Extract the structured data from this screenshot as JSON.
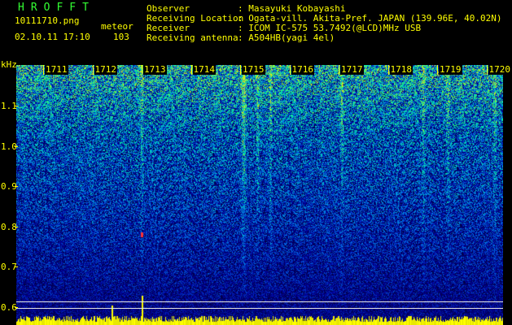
{
  "header": {
    "title": "HROFFT",
    "filename": "10111710.png",
    "date_time": "02.10.11 17:10",
    "mode_label": "meteor",
    "count": "103"
  },
  "station": {
    "observer_label": "Observer",
    "observer_value": ": Masayuki Kobayashi",
    "location_label": "Receiving Location",
    "location_value": ": Ogata-vill. Akita-Pref. JAPAN (139.96E, 40.02N)",
    "receiver_label": "Receiver",
    "receiver_value": ": ICOM IC-575 53.7492(@LCD)MHz USB",
    "antenna_label": "Receiving antenna",
    "antenna_value": ": A504HB(yagi 4el)"
  },
  "axis": {
    "y_unit": "kHz",
    "y_ticks": [
      "1.1",
      "1.0",
      "0.9",
      "0.8",
      "0.7",
      "0.6"
    ],
    "x_ticks": [
      "1711",
      "1712",
      "1713",
      "1714",
      "1715",
      "1716",
      "1717",
      "1718",
      "1719",
      "1720"
    ]
  },
  "colors": {
    "text": "#ffff00",
    "title": "#33ff33",
    "background": "#000000"
  }
}
